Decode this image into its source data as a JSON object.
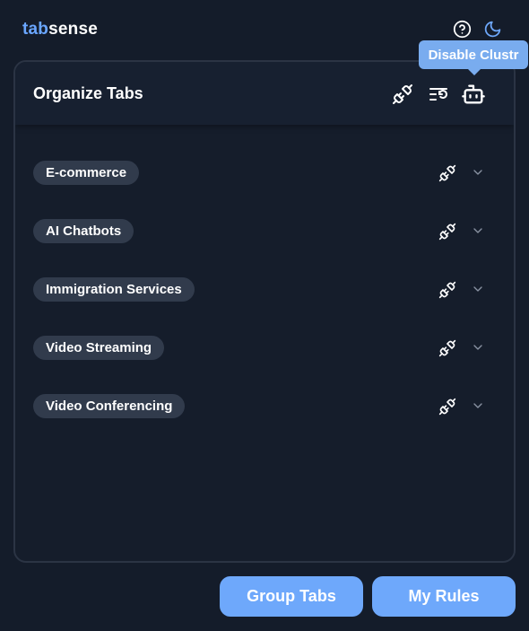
{
  "app": {
    "logo_accent": "tab",
    "logo_rest": "sense"
  },
  "header_icons": {
    "help": "help-circle-icon",
    "theme": "moon-icon"
  },
  "tooltip": {
    "text": "Disable Clustr"
  },
  "panel": {
    "title": "Organize Tabs",
    "actions": [
      "plug-icon",
      "list-restore-icon",
      "bot-icon"
    ]
  },
  "groups": [
    {
      "label": "E-commerce"
    },
    {
      "label": "AI Chatbots"
    },
    {
      "label": "Immigration Services"
    },
    {
      "label": "Video Streaming"
    },
    {
      "label": "Video Conferencing"
    }
  ],
  "footer": {
    "group_tabs_label": "Group Tabs",
    "my_rules_label": "My Rules"
  },
  "colors": {
    "background": "#141c2a",
    "accent": "#6ea8fb",
    "chip": "#313b4c"
  }
}
